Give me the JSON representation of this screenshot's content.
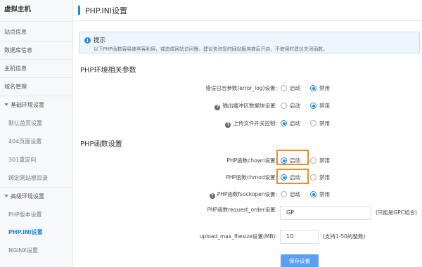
{
  "sidebar": {
    "title": "虚拟主机",
    "items": [
      {
        "label": "站点信息"
      },
      {
        "label": "数据库信息"
      },
      {
        "label": "主机信息"
      },
      {
        "label": "域名管理"
      },
      {
        "label": "基础环境设置"
      },
      {
        "label": "默认首页设置"
      },
      {
        "label": "404页面设置"
      },
      {
        "label": "301重定向"
      },
      {
        "label": "绑定网站根目录"
      },
      {
        "label": "高级环境设置"
      },
      {
        "label": "PHP版本设置"
      },
      {
        "label": "PHP.INI设置"
      },
      {
        "label": "NGINX设置"
      }
    ],
    "active_item": "PHP.INI设置"
  },
  "header": {
    "title": "PHP.INI设置"
  },
  "notice": {
    "title": "提示",
    "text": "以下PHP函数容易被黑客利用，或造成网站访问慢，建议咨询您的网站服务商后开启，不使用时建议关闭函数。"
  },
  "sections": {
    "env_title": "PHP环境相关参数",
    "func_title": "PHP函数设置"
  },
  "radio_labels": {
    "on": "启动",
    "off": "禁用"
  },
  "settings": {
    "error_log": {
      "label": "错误日志参数(error_log)设置:",
      "value": "off"
    },
    "output_buffering": {
      "label": "输出缓冲区数据块设置:",
      "value": "off"
    },
    "file_uploads": {
      "label": "上传文件开关控制:",
      "value": "on"
    },
    "chown": {
      "label": "PHP函数chown设置:",
      "value": "on"
    },
    "chmod": {
      "label": "PHP函数chmod设置:",
      "value": "on"
    },
    "fsockopen": {
      "label": "PHP函数fsockopen设置:",
      "value": "off"
    },
    "request_order": {
      "label": "PHP函数request_order设置:",
      "value": "GP",
      "hint": "(只能是GPC组合)"
    },
    "upload_max_filesize": {
      "label": "upload_max_filesize设置(MB):",
      "value": "10",
      "hint": "(支持1-50的整数)"
    }
  },
  "save_button": "保存设置",
  "colors": {
    "accent": "#1e88e5",
    "highlight": "#f08a24",
    "button": "#5aa0f0"
  }
}
